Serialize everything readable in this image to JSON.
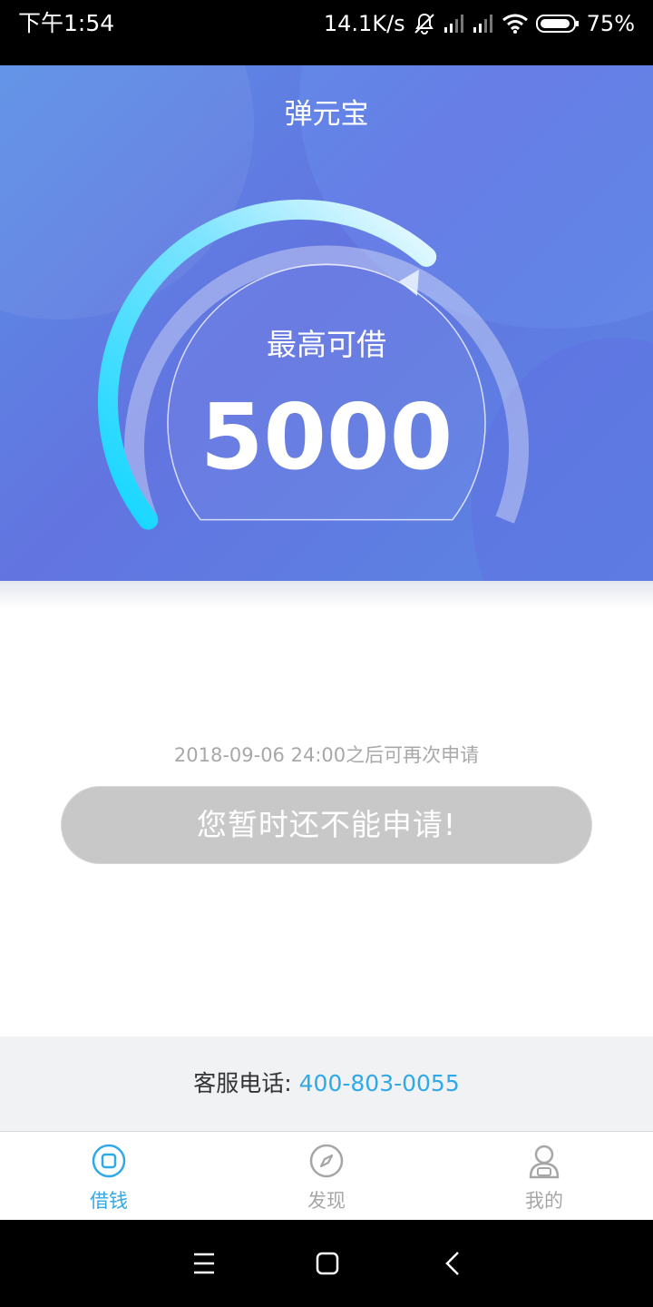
{
  "status_bar": {
    "time": "下午1:54",
    "network_speed": "14.1K/s",
    "battery": "75%"
  },
  "hero": {
    "title": "弹元宝",
    "gauge_label": "最高可借",
    "gauge_value": "5000"
  },
  "apply": {
    "note": "2018-09-06 24:00之后可再次申请",
    "button_label": "您暂时还不能申请!"
  },
  "service": {
    "label": "客服电话:",
    "phone": "400-803-0055"
  },
  "tabs": [
    {
      "label": "借钱",
      "icon": "borrow-icon",
      "active": true
    },
    {
      "label": "发现",
      "icon": "compass-icon",
      "active": false
    },
    {
      "label": "我的",
      "icon": "user-icon",
      "active": false
    }
  ],
  "nav": {
    "buttons": [
      "menu-icon",
      "home-icon",
      "back-icon"
    ]
  },
  "colors": {
    "accent": "#2fa9e8",
    "hero": "#5f7fe3",
    "button_disabled": "#c9c8c9",
    "tab_inactive": "#a6a6a6"
  }
}
